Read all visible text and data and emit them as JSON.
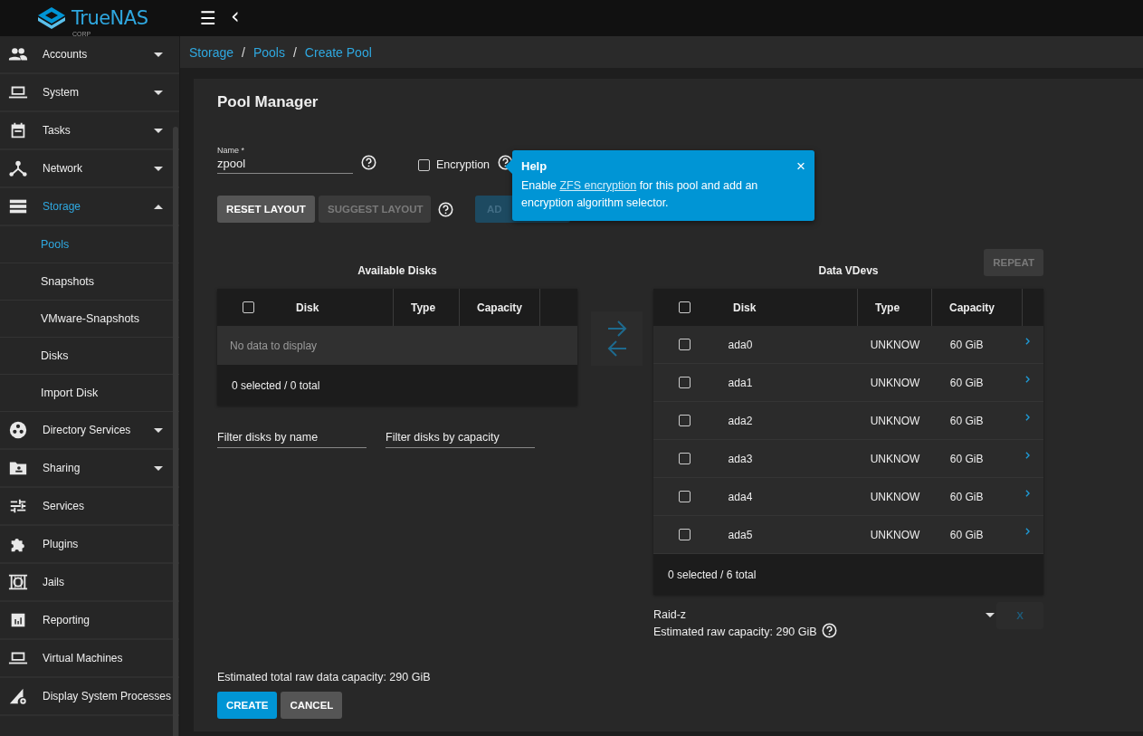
{
  "brand": {
    "name": "TrueNAS",
    "sub": "CORP"
  },
  "topbar": {
    "menu_glyph": "☰",
    "back_glyph": "‹"
  },
  "sidebar": {
    "items": [
      {
        "label": "Accounts",
        "expandable": true,
        "expanded": false,
        "selected": false
      },
      {
        "label": "System",
        "expandable": true,
        "expanded": false,
        "selected": false
      },
      {
        "label": "Tasks",
        "expandable": true,
        "expanded": false,
        "selected": false
      },
      {
        "label": "Network",
        "expandable": true,
        "expanded": false,
        "selected": false
      },
      {
        "label": "Storage",
        "expandable": true,
        "expanded": true,
        "selected": true,
        "children": [
          {
            "label": "Pools",
            "selected": true
          },
          {
            "label": "Snapshots",
            "selected": false
          },
          {
            "label": "VMware-Snapshots",
            "selected": false
          },
          {
            "label": "Disks",
            "selected": false
          },
          {
            "label": "Import Disk",
            "selected": false
          }
        ]
      },
      {
        "label": "Directory Services",
        "expandable": true,
        "expanded": false,
        "selected": false
      },
      {
        "label": "Sharing",
        "expandable": true,
        "expanded": false,
        "selected": false
      },
      {
        "label": "Services",
        "expandable": false,
        "selected": false
      },
      {
        "label": "Plugins",
        "expandable": false,
        "selected": false
      },
      {
        "label": "Jails",
        "expandable": false,
        "selected": false
      },
      {
        "label": "Reporting",
        "expandable": false,
        "selected": false
      },
      {
        "label": "Virtual Machines",
        "expandable": false,
        "selected": false
      },
      {
        "label": "Display System Processes",
        "expandable": false,
        "selected": false
      }
    ]
  },
  "breadcrumb": {
    "separator": "/",
    "items": [
      "Storage",
      "Pools",
      "Create Pool"
    ]
  },
  "title": "Pool Manager",
  "name_field": {
    "label": "Name *",
    "value": "zpool"
  },
  "encryption": {
    "label": "Encryption",
    "checked": false
  },
  "help_popup": {
    "title": "Help",
    "close": "×",
    "text_before": "Enable ",
    "link": "ZFS encryption",
    "text_after": " for this pool and add an encryption algorithm selector."
  },
  "layout_buttons": [
    {
      "label": "RESET LAYOUT",
      "disabled": false
    },
    {
      "label": "SUGGEST LAYOUT",
      "disabled": true
    }
  ],
  "add_vdev_button": {
    "label": "AD",
    "disabled": true
  },
  "available": {
    "title": "Available Disks",
    "columns": [
      "Disk",
      "Type",
      "Capacity"
    ],
    "all_checked": false,
    "empty": "No data to display",
    "footer": "0 selected / 0 total",
    "filters": [
      {
        "placeholder": "Filter disks by name"
      },
      {
        "placeholder": "Filter disks by capacity"
      }
    ]
  },
  "data_vdevs": {
    "title": "Data VDevs",
    "repeat": {
      "label": "REPEAT",
      "disabled": true
    },
    "columns": [
      "Disk",
      "Type",
      "Capacity"
    ],
    "all_checked": false,
    "rows": [
      {
        "disk": "ada0",
        "type": "UNKNOW",
        "capacity": "60 GiB",
        "checked": false
      },
      {
        "disk": "ada1",
        "type": "UNKNOW",
        "capacity": "60 GiB",
        "checked": false
      },
      {
        "disk": "ada2",
        "type": "UNKNOW",
        "capacity": "60 GiB",
        "checked": false
      },
      {
        "disk": "ada3",
        "type": "UNKNOW",
        "capacity": "60 GiB",
        "checked": false
      },
      {
        "disk": "ada4",
        "type": "UNKNOW",
        "capacity": "60 GiB",
        "checked": false
      },
      {
        "disk": "ada5",
        "type": "UNKNOW",
        "capacity": "60 GiB",
        "checked": false
      }
    ],
    "footer": "0 selected / 6 total",
    "layout": "Raid-z",
    "estimate": "Estimated raw capacity: 290 GiB",
    "remove": {
      "label": "X",
      "disabled": true
    }
  },
  "total_estimate": "Estimated total raw data capacity: 290 GiB",
  "actions": [
    {
      "label": "CREATE",
      "kind": "primary"
    },
    {
      "label": "CANCEL",
      "kind": "secondary"
    }
  ]
}
